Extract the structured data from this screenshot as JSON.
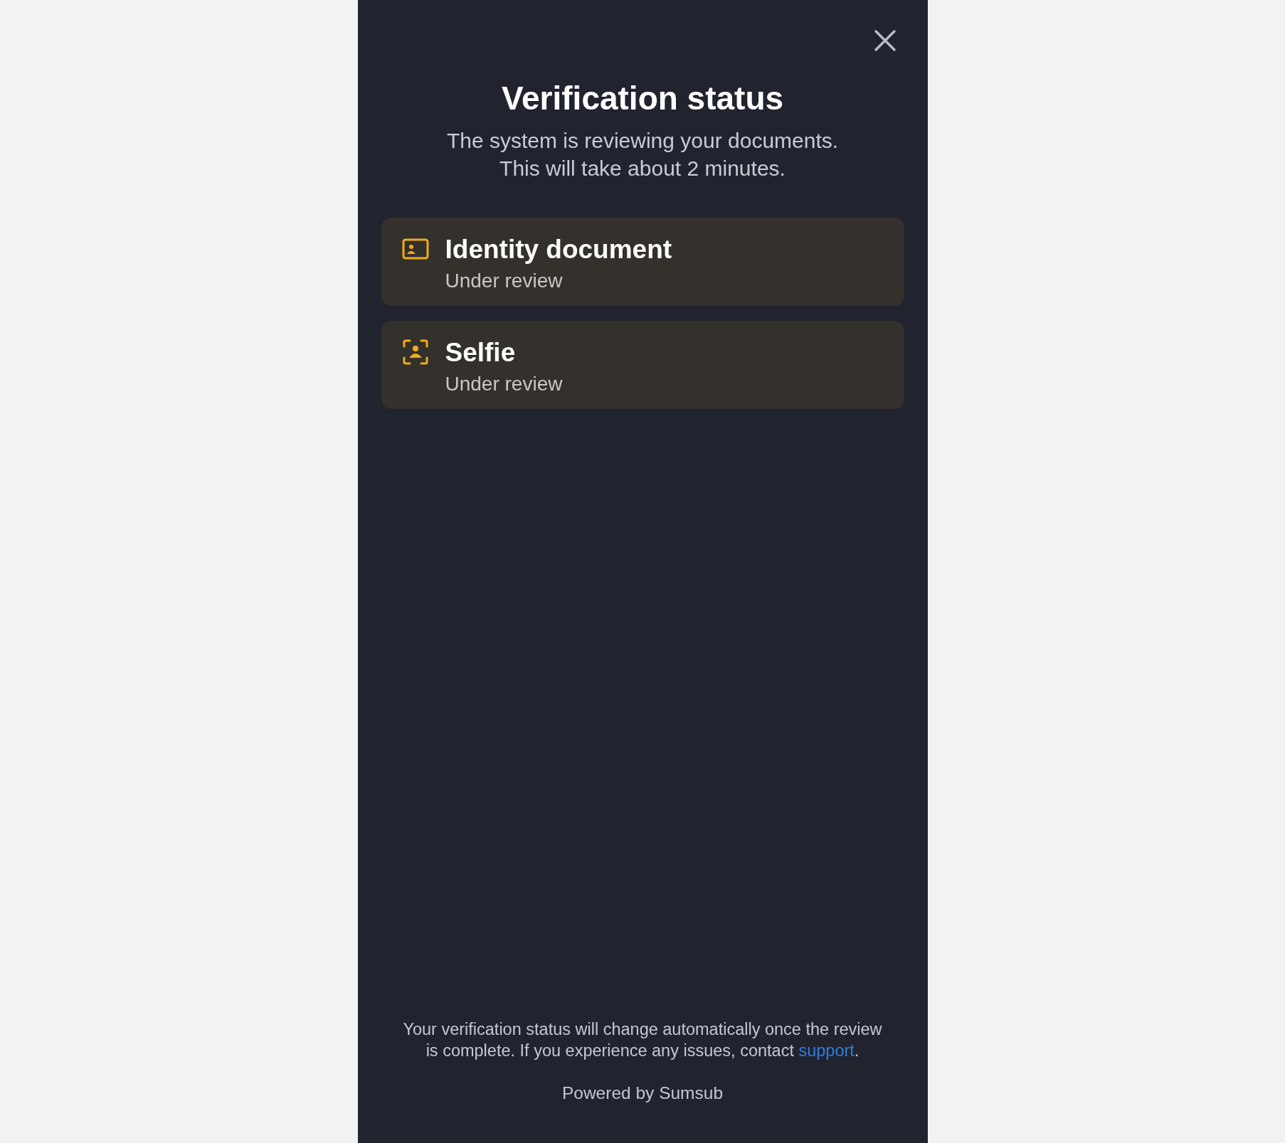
{
  "title": "Verification status",
  "subtitle_lines": [
    "The system is reviewing your documents.",
    "This will take about 2 minutes."
  ],
  "items": [
    {
      "kind": "document",
      "title": "Identity document",
      "status": "Under review"
    },
    {
      "kind": "selfie",
      "title": "Selfie",
      "status": "Under review"
    }
  ],
  "footer": {
    "text": "Your verification status will change automatically once the review is complete. If you experience any issues, contact",
    "link": "support",
    "after": "."
  },
  "powered_by": "Powered by Sumsub"
}
